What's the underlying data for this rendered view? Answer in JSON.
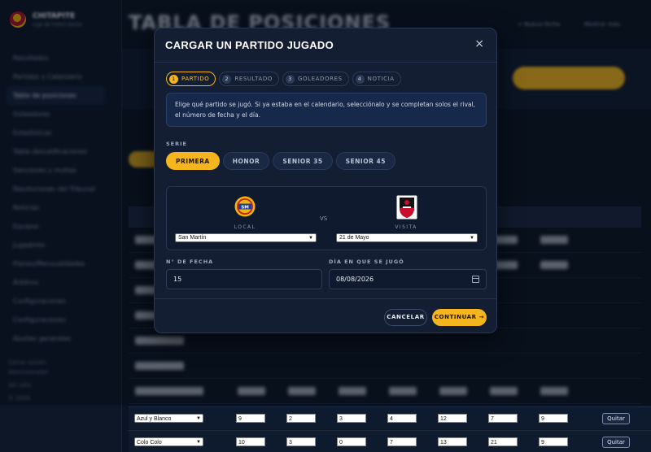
{
  "app": {
    "brand_name": "CHITAPITE",
    "brand_sub": "Liga de fútbol senior",
    "page_title": "TABLA DE POSICIONES",
    "topbar_links": [
      "+ Nueva fecha",
      "Mostrar más"
    ],
    "nav_items": [
      "Resultados",
      "Partidos y Calendario",
      "Tabla de posiciones",
      "Goleadores",
      "Estadísticas",
      "Tabla descalificaciones",
      "Sanciones y multas",
      "Resoluciones del Tribunal",
      "Noticias",
      "Equipos",
      "Jugadores",
      "Planes/Mensualidades",
      "Árbitros",
      "Configuraciones",
      "Configuraciones",
      "Ajustes generales"
    ],
    "nav_foot": [
      "Cerrar sesión",
      "Administrador",
      "Ver sitio",
      "© 2026"
    ]
  },
  "modal": {
    "title": "CARGAR UN PARTIDO JUGADO",
    "close_glyph": "×",
    "steps": [
      {
        "num": "1",
        "label": "PARTIDO"
      },
      {
        "num": "2",
        "label": "RESULTADO"
      },
      {
        "num": "3",
        "label": "GOLEADORES"
      },
      {
        "num": "4",
        "label": "NOTICIA"
      }
    ],
    "info_text": "Elige qué partido se jugó. Si ya estaba en el calendario, selecciónalo y se completan solos el rival, el número de fecha y el día.",
    "serie_label": "SERIE",
    "series": [
      "PRIMERA",
      "HONOR",
      "SENIOR 35",
      "SENIOR 45"
    ],
    "local_label": "LOCAL",
    "visita_label": "VISITA",
    "vs_text": "VS",
    "local_team": "San Martín",
    "visita_team": "21 de Mayo",
    "fecha_label": "N° DE FECHA",
    "fecha_value": "15",
    "dia_label": "DÍA EN QUE SE JUGÓ",
    "dia_value": "08/08/2026",
    "cancel_label": "CANCELAR",
    "continue_label": "CONTINUAR →"
  },
  "table_rows": [
    {
      "team": "Azul y Blanco",
      "values": [
        "9",
        "2",
        "3",
        "4",
        "12",
        "7",
        "9"
      ],
      "action": "Quitar"
    },
    {
      "team": "Colo Colo",
      "values": [
        "10",
        "3",
        "0",
        "7",
        "13",
        "21",
        "9"
      ],
      "action": "Quitar"
    }
  ],
  "colors": {
    "accent": "#f5b51e",
    "background": "#0b1424",
    "modal_bg": "#131e33"
  }
}
